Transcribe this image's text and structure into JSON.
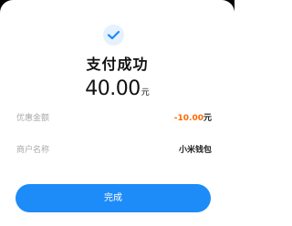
{
  "status": {
    "icon": "checkmark-icon",
    "title": "支付成功"
  },
  "payment": {
    "amount": "40.00",
    "currency": "元"
  },
  "details": {
    "discount_label": "优惠金额",
    "discount_value": "-10.00",
    "discount_unit": "元",
    "merchant_label": "商户名称",
    "merchant_value": "小米钱包"
  },
  "actions": {
    "done_label": "完成"
  },
  "colors": {
    "accent": "#1d8bf8",
    "discount": "#ff6a00",
    "check_bg": "#e6f1ff"
  }
}
